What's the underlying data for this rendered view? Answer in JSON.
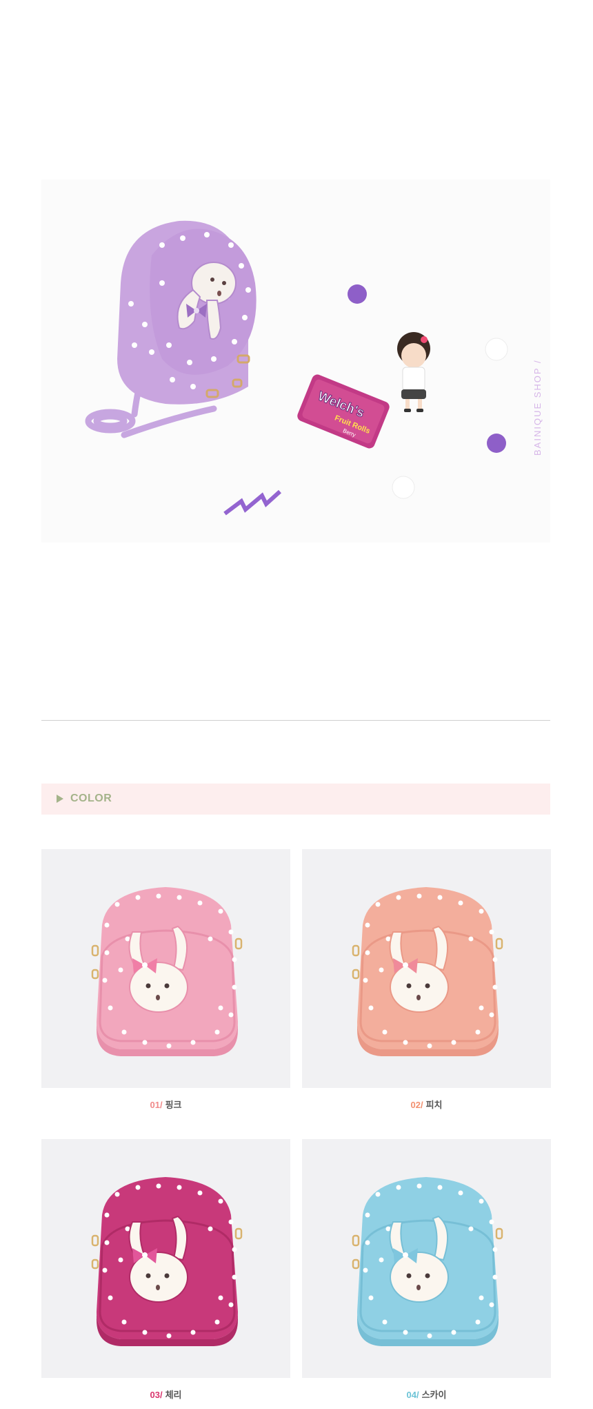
{
  "hero": {
    "watermark": "BAINIQUE SHOP  /",
    "candy_brand": "Welch's",
    "candy_product": "Fruit Rolls",
    "candy_flavor": "Berry"
  },
  "section": {
    "color_label": "COLOR"
  },
  "colors": [
    {
      "num": "01/",
      "name": "핑크",
      "num_color": "#f08a8a",
      "bag": "#f2a7bd",
      "bag_dark": "#e890ab",
      "bow": "#f07ea6"
    },
    {
      "num": "02/",
      "name": "피치",
      "num_color": "#f2906f",
      "bag": "#f3ae9c",
      "bag_dark": "#ea9987",
      "bow": "#f08a9a"
    },
    {
      "num": "03/",
      "name": "체리",
      "num_color": "#d9366e",
      "bag": "#c8397a",
      "bag_dark": "#b02b66",
      "bow": "#e2569a"
    },
    {
      "num": "04/",
      "name": "스카이",
      "num_color": "#6cc3d6",
      "bag": "#8fd0e4",
      "bag_dark": "#77bfd6",
      "bow": "#7fc6de"
    }
  ]
}
